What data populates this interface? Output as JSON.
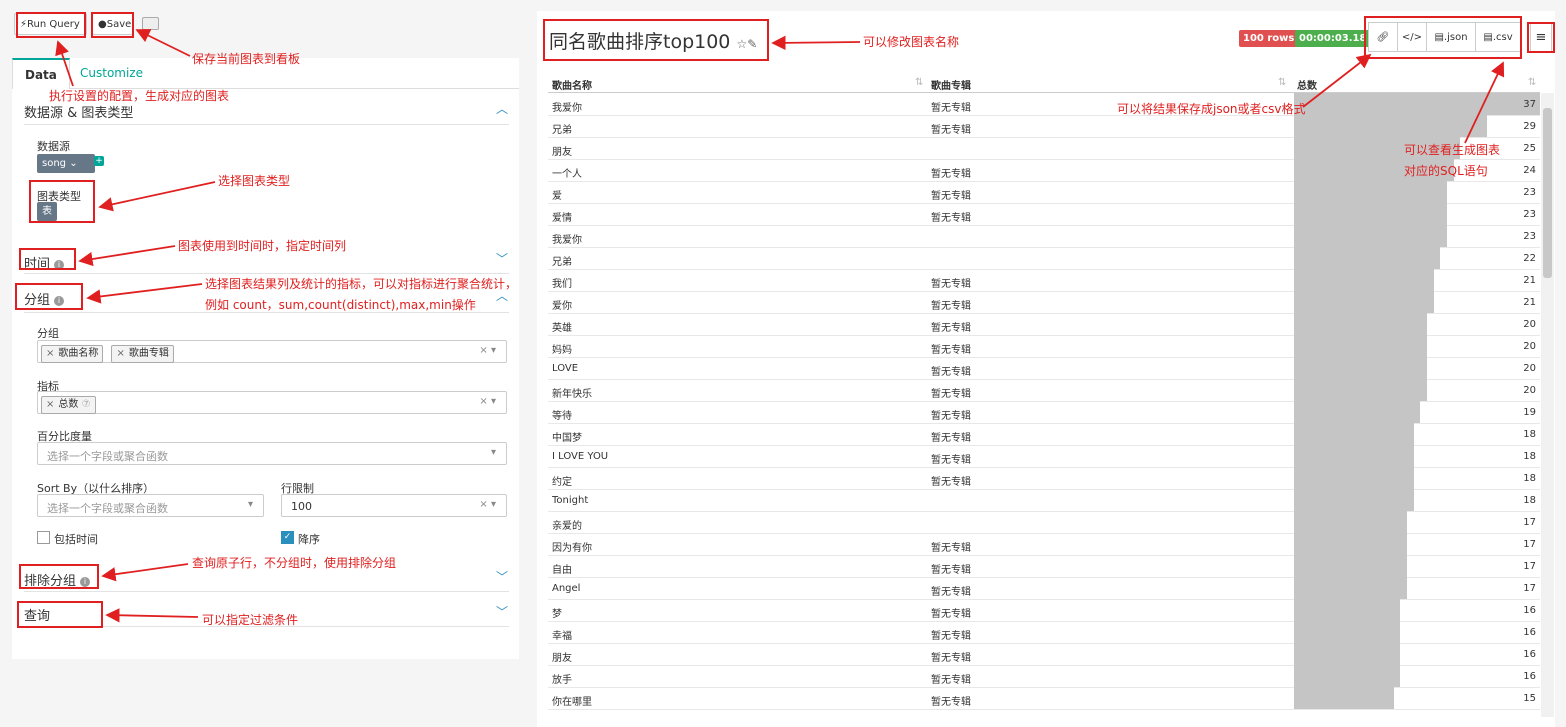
{
  "toolbar": {
    "run_label": "Run Query",
    "save_label": "Save"
  },
  "tabs": {
    "data": "Data",
    "customize": "Customize"
  },
  "sections": {
    "datasource_chart": "数据源 & 图表类型",
    "time": "时间",
    "group": "分组",
    "exclude_group": "排除分组",
    "query": "查询"
  },
  "datasource": {
    "label": "数据源",
    "value": "song"
  },
  "chart_type": {
    "label": "图表类型",
    "value": "表"
  },
  "groupby": {
    "label": "分组",
    "tags": [
      "歌曲名称",
      "歌曲专辑"
    ]
  },
  "metrics": {
    "label": "指标",
    "tags": [
      "总数"
    ]
  },
  "percent": {
    "label": "百分比度量",
    "placeholder": "选择一个字段或聚合函数"
  },
  "sortby": {
    "label": "Sort By（以什么排序）",
    "placeholder": "选择一个字段或聚合函数"
  },
  "row_limit": {
    "label": "行限制",
    "value": "100"
  },
  "include_time": {
    "label": "包括时间",
    "checked": false
  },
  "descending": {
    "label": "降序",
    "checked": true
  },
  "annotations": {
    "save": "保存当前图表到看板",
    "run": "执行设置的配置，生成对应的图表",
    "chart_type": "选择图表类型",
    "time": "图表使用到时间时，指定时间列",
    "group_line1": "选择图表结果列及统计的指标，可以对指标进行聚合统计，",
    "group_line2": "例如 count，sum,count(distinct),max,min操作",
    "exclude": "查询原子行，不分组时，使用排除分组",
    "query": "可以指定过滤条件",
    "title": "可以修改图表名称",
    "export": "可以将结果保存成json或者csv格式",
    "sql_line1": "可以查看生成图表",
    "sql_line2": "对应的SQL语句"
  },
  "chart_title": "同名歌曲排序top100",
  "rows_badge": "100 rows",
  "time_badge": "00:00:03.18",
  "buttons": {
    "json": ".json",
    "csv": ".csv"
  },
  "colors": {
    "accent": "#00a699",
    "danger": "#e05050",
    "success": "#4cae4c",
    "annotation": "#e02020",
    "bar": "#c5c5c5"
  },
  "table": {
    "headers": [
      "歌曲名称",
      "歌曲专辑",
      "总数"
    ],
    "max": 37,
    "rows": [
      [
        "我爱你",
        "暂无专辑",
        37
      ],
      [
        "兄弟",
        "暂无专辑",
        29
      ],
      [
        "朋友",
        "",
        25
      ],
      [
        "一个人",
        "暂无专辑",
        24
      ],
      [
        "爱",
        "暂无专辑",
        23
      ],
      [
        "爱情",
        "暂无专辑",
        23
      ],
      [
        "我爱你",
        "",
        23
      ],
      [
        "兄弟",
        "",
        22
      ],
      [
        "我们",
        "暂无专辑",
        21
      ],
      [
        "爱你",
        "暂无专辑",
        21
      ],
      [
        "英雄",
        "暂无专辑",
        20
      ],
      [
        "妈妈",
        "暂无专辑",
        20
      ],
      [
        "LOVE",
        "暂无专辑",
        20
      ],
      [
        "新年快乐",
        "暂无专辑",
        20
      ],
      [
        "等待",
        "暂无专辑",
        19
      ],
      [
        "中国梦",
        "暂无专辑",
        18
      ],
      [
        "I LOVE YOU",
        "暂无专辑",
        18
      ],
      [
        "约定",
        "暂无专辑",
        18
      ],
      [
        "Tonight",
        "",
        18
      ],
      [
        "亲爱的",
        "",
        17
      ],
      [
        "因为有你",
        "暂无专辑",
        17
      ],
      [
        "自由",
        "暂无专辑",
        17
      ],
      [
        "Angel",
        "暂无专辑",
        17
      ],
      [
        "梦",
        "暂无专辑",
        16
      ],
      [
        "幸福",
        "暂无专辑",
        16
      ],
      [
        "朋友",
        "暂无专辑",
        16
      ],
      [
        "放手",
        "暂无专辑",
        16
      ],
      [
        "你在哪里",
        "暂无专辑",
        15
      ]
    ]
  }
}
